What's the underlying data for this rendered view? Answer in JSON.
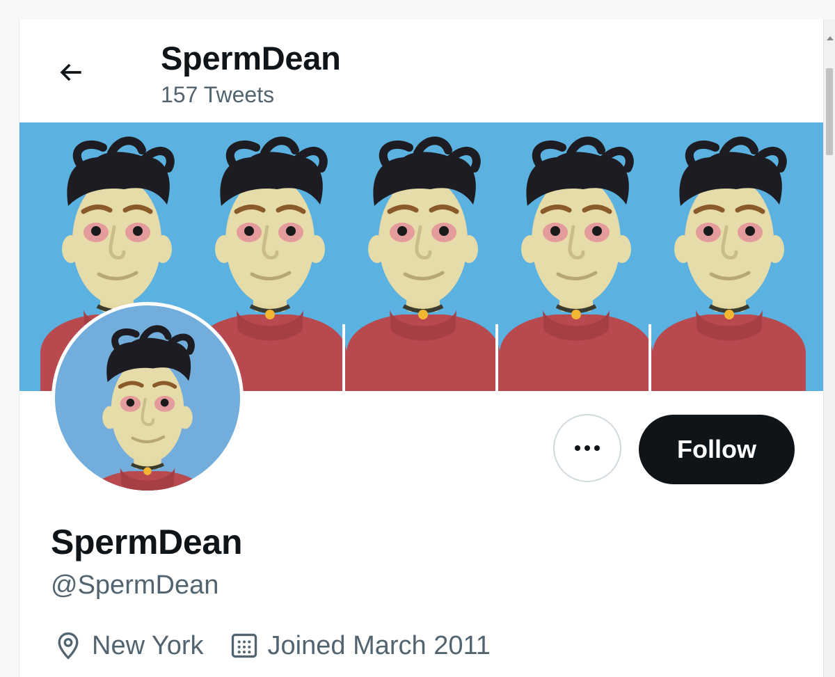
{
  "header": {
    "name": "SpermDean",
    "tweet_count": "157 Tweets"
  },
  "profile": {
    "display_name": "SpermDean",
    "handle": "@SpermDean",
    "location": "New York",
    "joined": "Joined March 2011"
  },
  "actions": {
    "follow_label": "Follow",
    "more_label": "•••"
  },
  "icons": {
    "back": "arrow-left-icon",
    "more": "more-dots-icon",
    "location": "location-pin-icon",
    "calendar": "calendar-icon"
  },
  "colors": {
    "banner_bg": "#5bb1df",
    "avatar_bg": "#72addb",
    "follow_bg": "#0f1419",
    "secondary_text": "#536471"
  }
}
